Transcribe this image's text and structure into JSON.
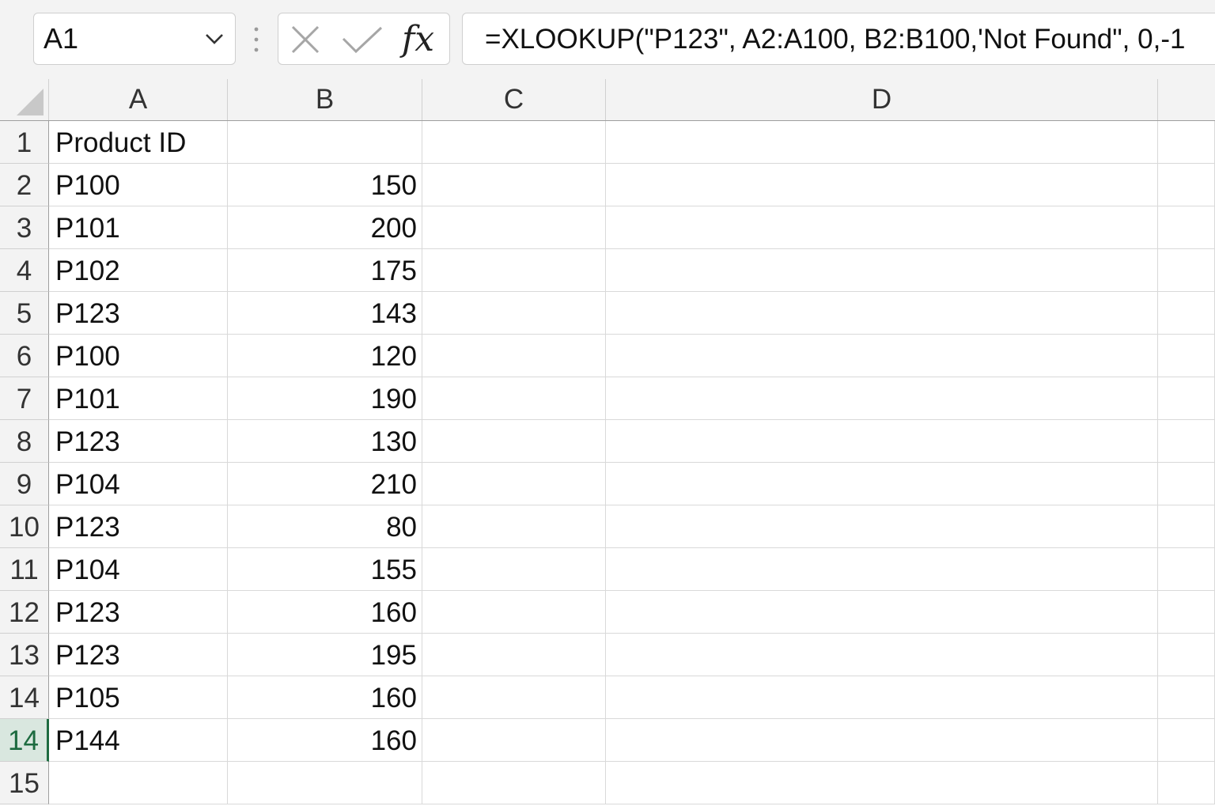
{
  "formula_bar": {
    "name_box": "A1",
    "fx_label": "fx",
    "formula": "=XLOOKUP(\"P123\", A2:A100, B2:B100,'Not Found\", 0,-1"
  },
  "columns": [
    "A",
    "B",
    "C",
    "D"
  ],
  "rows": [
    {
      "num": "1",
      "a": "Product ID",
      "b": ""
    },
    {
      "num": "2",
      "a": "P100",
      "b": "150"
    },
    {
      "num": "3",
      "a": "P101",
      "b": "200"
    },
    {
      "num": "4",
      "a": "P102",
      "b": "175"
    },
    {
      "num": "5",
      "a": "P123",
      "b": "143"
    },
    {
      "num": "6",
      "a": "P100",
      "b": "120"
    },
    {
      "num": "7",
      "a": "P101",
      "b": "190"
    },
    {
      "num": "8",
      "a": "P123",
      "b": "130"
    },
    {
      "num": "9",
      "a": "P104",
      "b": "210"
    },
    {
      "num": "10",
      "a": "P123",
      "b": "80"
    },
    {
      "num": "11",
      "a": "P104",
      "b": "155"
    },
    {
      "num": "12",
      "a": "P123",
      "b": "160"
    },
    {
      "num": "13",
      "a": "P123",
      "b": "195"
    },
    {
      "num": "14",
      "a": "P105",
      "b": "160"
    },
    {
      "num": "14",
      "a": "P144",
      "b": "160"
    },
    {
      "num": "15",
      "a": "",
      "b": ""
    }
  ],
  "selected_row_index": 14,
  "colors": {
    "accent": "#1d6b40",
    "selected_header_bg": "#d9e7df",
    "header_bg": "#f3f3f3",
    "gridline": "#d9d9d9"
  }
}
